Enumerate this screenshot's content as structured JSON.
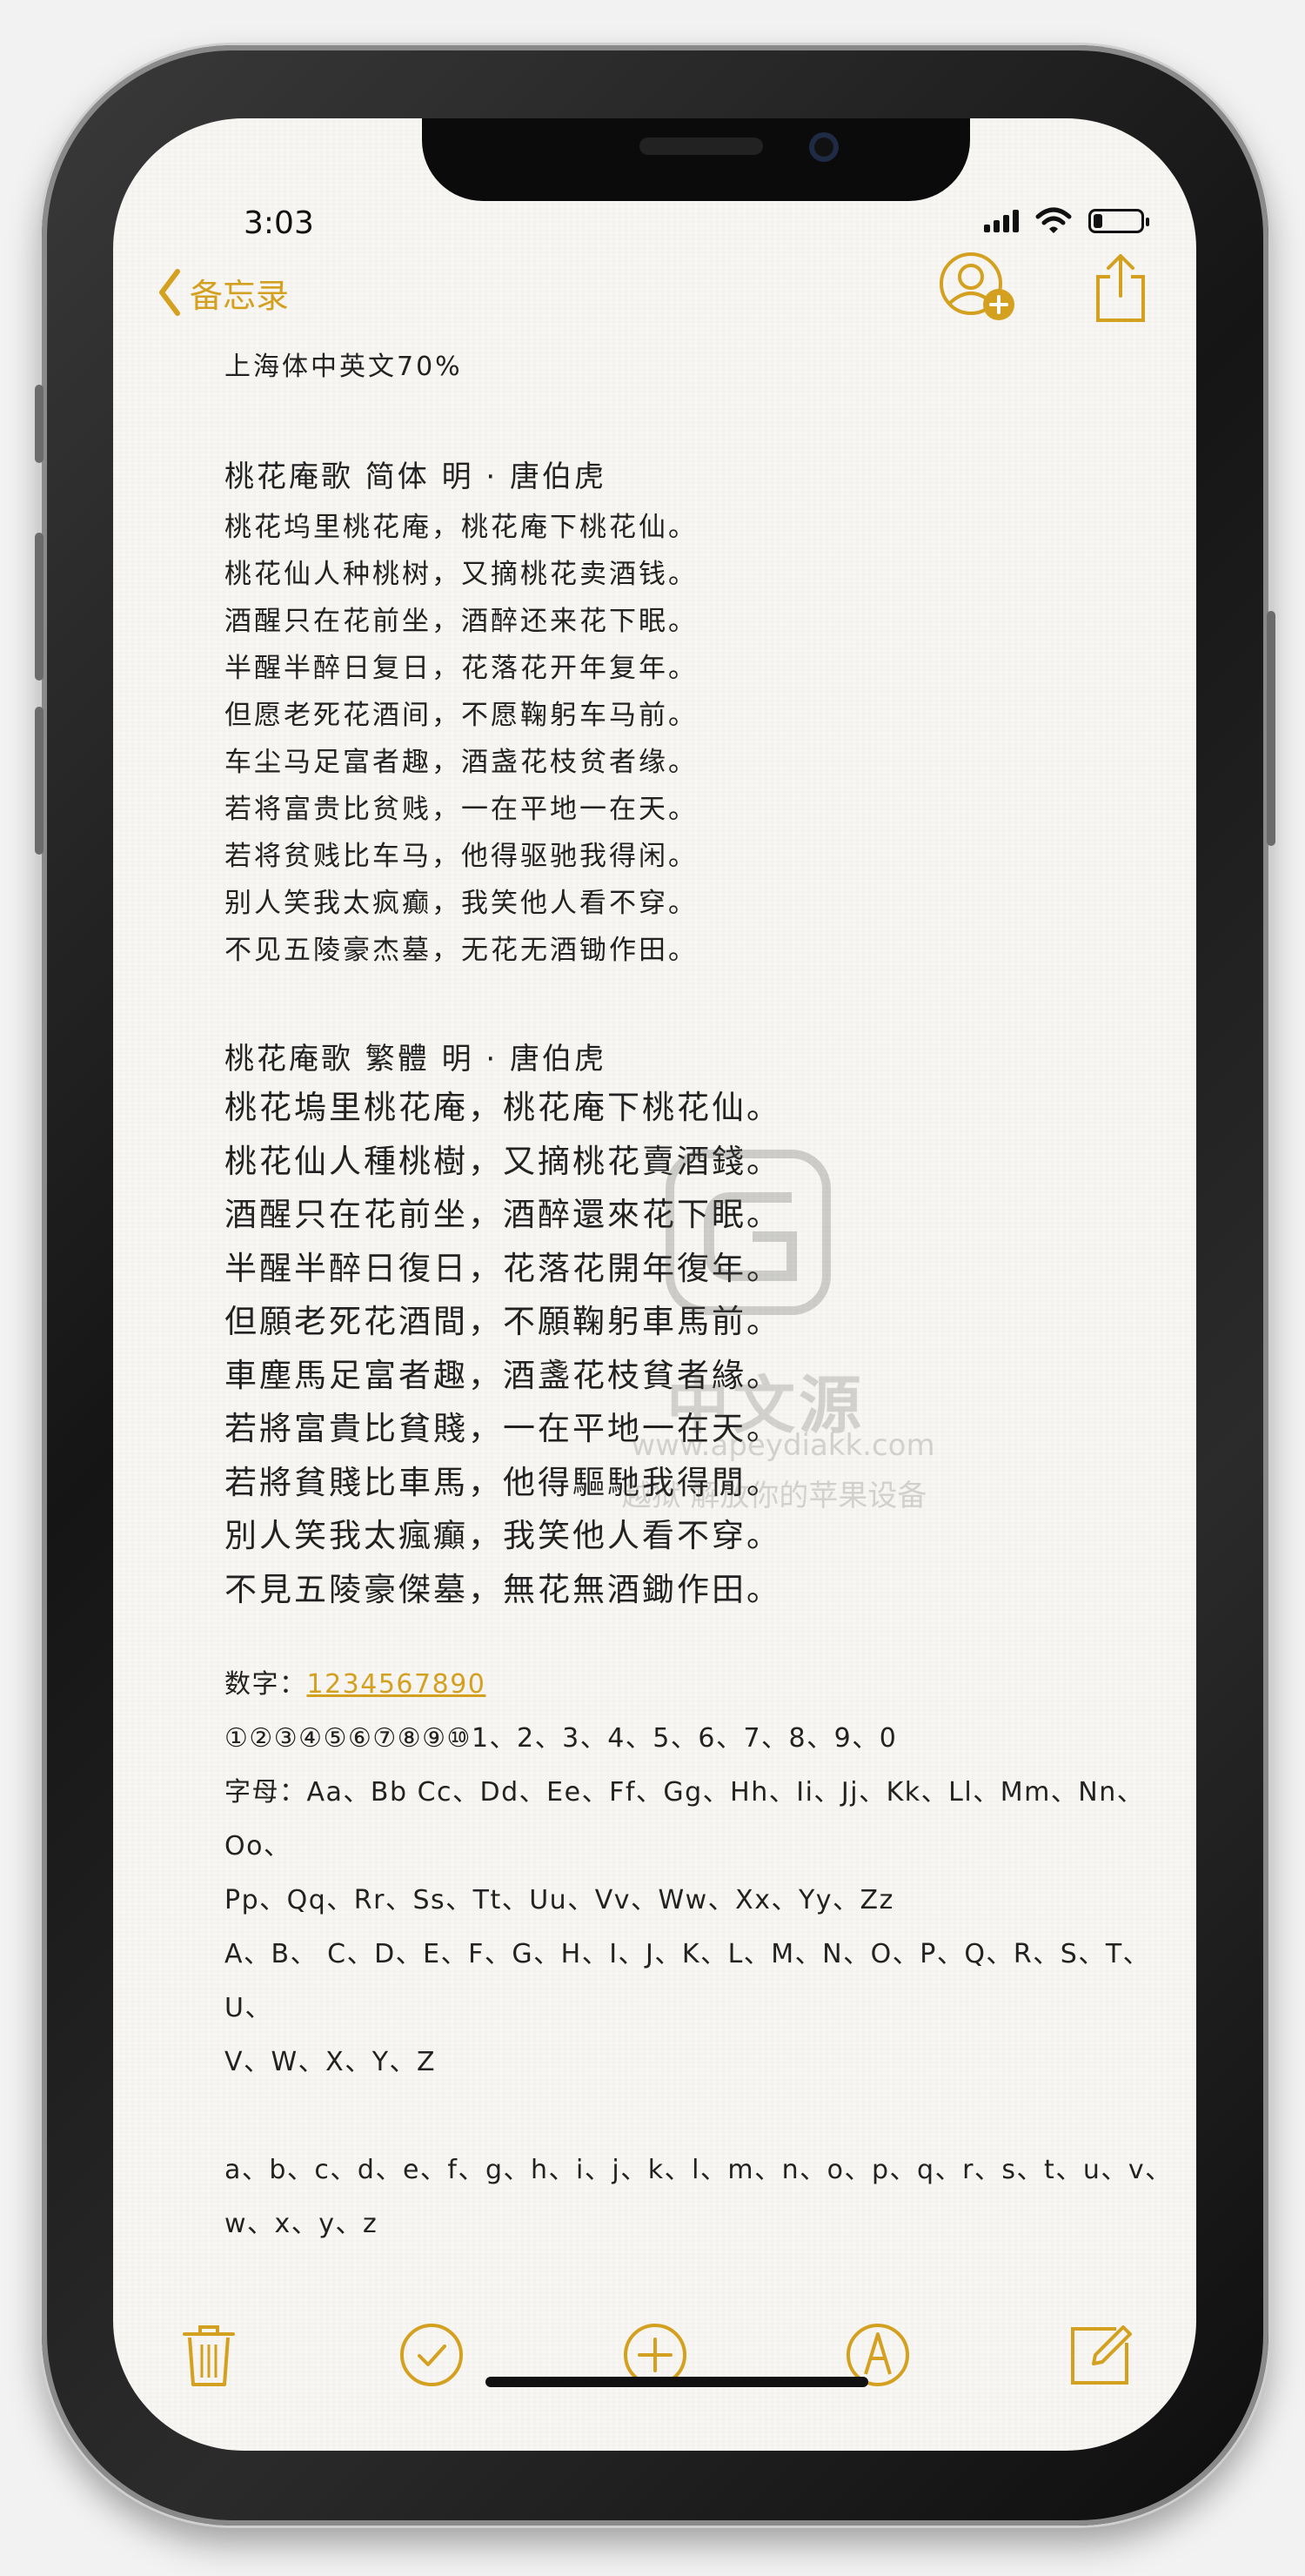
{
  "status_bar": {
    "time": "3:03"
  },
  "nav": {
    "back_label": "备忘录",
    "icons": [
      "chevron-left-icon",
      "add-person-icon",
      "share-icon"
    ]
  },
  "note": {
    "heading": "上海体中英文70%",
    "simplified": {
      "title": "桃花庵歌  简体   明 · 唐伯虎",
      "lines": [
        "桃花坞里桃花庵，桃花庵下桃花仙。",
        "桃花仙人种桃树，又摘桃花卖酒钱。",
        "酒醒只在花前坐，酒醉还来花下眠。",
        "半醒半醉日复日，花落花开年复年。",
        "但愿老死花酒间，不愿鞠躬车马前。",
        "车尘马足富者趣，酒盏花枝贫者缘。",
        "若将富贵比贫贱，一在平地一在天。",
        "若将贫贱比车马，他得驱驰我得闲。",
        "别人笑我太疯癫，我笑他人看不穿。",
        "不见五陵豪杰墓，无花无酒锄作田。"
      ]
    },
    "traditional": {
      "title": "桃花庵歌  繁體     明 · 唐伯虎",
      "lines": [
        "桃花塢里桃花庵，桃花庵下桃花仙。",
        "桃花仙人種桃樹，又摘桃花賣酒錢。",
        "酒醒只在花前坐，酒醉還來花下眠。",
        "半醒半醉日復日，花落花開年復年。",
        "但願老死花酒間，不願鞠躬車馬前。",
        "車塵馬足富者趣，酒盞花枝貧者緣。",
        "若將富貴比貧賤，一在平地一在天。",
        "若將貧賤比車馬，他得驅馳我得閒。",
        "別人笑我太瘋癲，我笑他人看不穿。",
        "不見五陵豪傑墓，無花無酒鋤作田。"
      ]
    },
    "digits_label": "数字：",
    "digits_link": "1234567890",
    "circled_numbers": "①②③④⑤⑥⑦⑧⑨⑩1、2、3、4、5、6、7、8、9、0",
    "letters_line1": "字母：Aa、Bb Cc、Dd、Ee、Ff、Gg、Hh、Ii、Jj、Kk、Ll、Mm、Nn、Oo、",
    "letters_line2": "Pp、Qq、Rr、Ss、Tt、Uu、Vv、Ww、Xx、Yy、Zz",
    "upper_line1": "A、B、 C、D、E、F、G、H、I、J、K、L、M、N、O、P、Q、R、S、T、U、",
    "upper_line2": "V、W、X、Y、Z",
    "lower_line1": "a、b、c、d、e、f、g、h、i、j、k、l、m、n、o、p、q、r、s、t、u、v、",
    "lower_line2": "w、x、y、z"
  },
  "toolbar": {
    "icons": [
      "trash-icon",
      "checklist-icon",
      "add-icon",
      "markup-icon",
      "compose-icon"
    ]
  },
  "watermark": {
    "title": "中文源",
    "url": "www.apeydiakk.com",
    "slogan": "越狱 解放你的苹果设备"
  },
  "colors": {
    "accent": "#d4a020",
    "text": "#222222",
    "paper": "#f8f7f3"
  }
}
